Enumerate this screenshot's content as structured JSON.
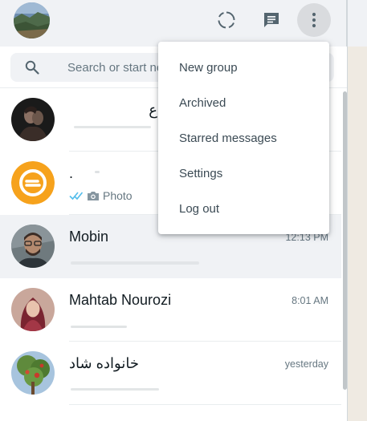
{
  "header": {
    "profile_avatar": "profile-landscape-photo",
    "status_icon": "status-ring-icon",
    "new_chat_icon": "new-chat-icon",
    "menu_icon": "more-vertical-icon"
  },
  "search": {
    "placeholder": "Search or start new chat",
    "icon": "search-icon"
  },
  "menu": {
    "items": [
      {
        "label": "New group"
      },
      {
        "label": "Archived"
      },
      {
        "label": "Starred messages"
      },
      {
        "label": "Settings"
      },
      {
        "label": "Log out"
      }
    ]
  },
  "chats": [
    {
      "name": "ع",
      "time": "",
      "preview": "",
      "avatar": "couple-photo"
    },
    {
      "name": ".",
      "time": "",
      "preview": "Photo",
      "avatar": "orange-logo",
      "status": "read"
    },
    {
      "name": "Mobin",
      "time": "12:13 PM",
      "preview": "",
      "avatar": "man-glasses-photo"
    },
    {
      "name": "Mahtab Nourozi",
      "time": "8:01 AM",
      "preview": "",
      "avatar": "woman-hijab-photo"
    },
    {
      "name": "خانواده شاد",
      "time": "yesterday",
      "preview": "",
      "avatar": "tree-photo"
    }
  ],
  "colors": {
    "header_bg": "#f0f2f5",
    "active_chat_bg": "#f0f2f5",
    "read_ticks": "#53bdeb",
    "secondary_text": "#667781"
  }
}
